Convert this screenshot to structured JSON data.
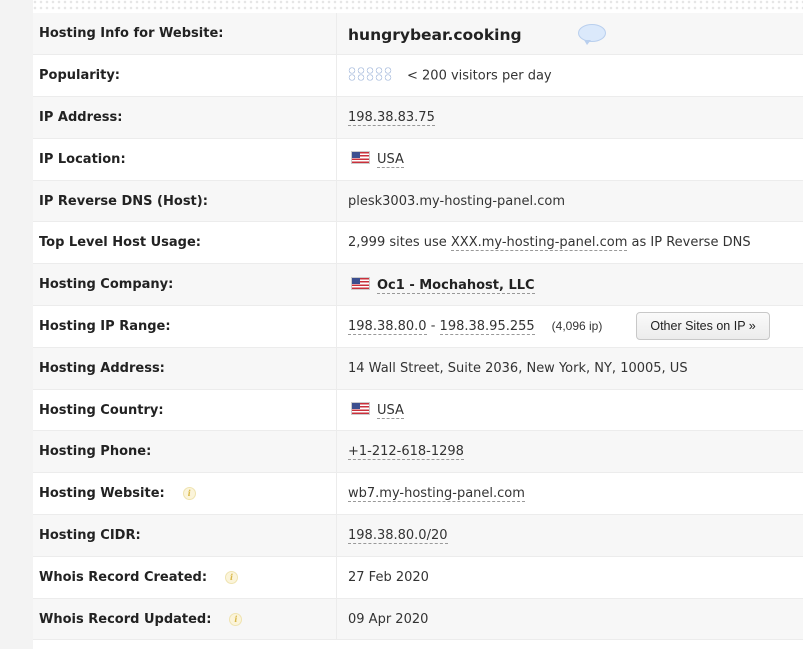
{
  "rows": [
    {
      "label": "Hosting Info for Website:",
      "value": "hungrybear.cooking"
    },
    {
      "label": "Popularity:",
      "value": "< 200 visitors per day"
    },
    {
      "label": "IP Address:",
      "value": "198.38.83.75"
    },
    {
      "label": "IP Location:",
      "value": "USA"
    },
    {
      "label": "IP Reverse DNS (Host):",
      "value": "plesk3003.my-hosting-panel.com"
    },
    {
      "label": "Top Level Host Usage:",
      "value_prefix": "2,999 sites use ",
      "value_link": "XXX.my-hosting-panel.com",
      "value_suffix": " as IP Reverse DNS"
    },
    {
      "label": "Hosting Company:",
      "value": "Oc1 - Mochahost, LLC"
    },
    {
      "label": "Hosting IP Range:",
      "range_start": "198.38.80.0",
      "range_sep": " - ",
      "range_end": "198.38.95.255",
      "ip_count": "(4,096 ip)",
      "button": "Other Sites on IP »"
    },
    {
      "label": "Hosting Address:",
      "value": "14 Wall Street, Suite 2036, New York, NY, 10005, US"
    },
    {
      "label": "Hosting Country:",
      "value": "USA"
    },
    {
      "label": "Hosting Phone:",
      "value": "+1-212-618-1298"
    },
    {
      "label": "Hosting Website:",
      "value": "wb7.my-hosting-panel.com"
    },
    {
      "label": "Hosting CIDR:",
      "value": "198.38.80.0/20"
    },
    {
      "label": "Whois Record Created:",
      "value": "27 Feb 2020"
    },
    {
      "label": "Whois Record Updated:",
      "value": "09 Apr 2020"
    }
  ],
  "popularity_icon_count": 5,
  "colors": {
    "flag_red": "#c9303b",
    "flag_blue": "#3c4f8f",
    "bubble": "#dbe9fb"
  }
}
